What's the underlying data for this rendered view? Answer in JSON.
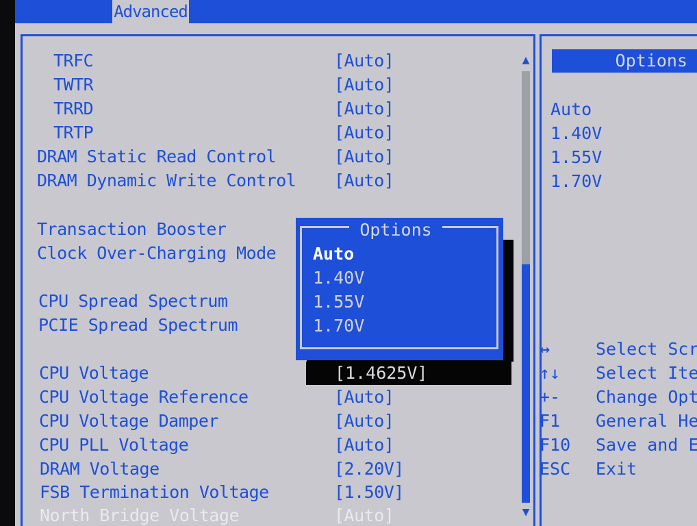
{
  "tab": "Advanced",
  "settings": [
    {
      "label": "TRFC",
      "value": "[Auto]"
    },
    {
      "label": "TWTR",
      "value": "[Auto]"
    },
    {
      "label": "TRRD",
      "value": "[Auto]"
    },
    {
      "label": "TRTP",
      "value": "[Auto]"
    },
    {
      "label": "DRAM Static Read Control",
      "value": "[Auto]"
    },
    {
      "label": "DRAM Dynamic Write Control",
      "value": "[Auto]"
    },
    {
      "label": "Transaction Booster",
      "value": ""
    },
    {
      "label": "Clock Over-Charging Mode",
      "value": ""
    },
    {
      "label": "CPU Spread Spectrum",
      "value": ""
    },
    {
      "label": "PCIE Spread Spectrum",
      "value": ""
    },
    {
      "label": "CPU Voltage",
      "value": "[1.4625V]"
    },
    {
      "label": "CPU Voltage Reference",
      "value": "[Auto]"
    },
    {
      "label": "CPU Voltage Damper",
      "value": "[Auto]"
    },
    {
      "label": "CPU PLL Voltage",
      "value": "[Auto]"
    },
    {
      "label": "DRAM Voltage",
      "value": "[2.20V]"
    },
    {
      "label": "FSB Termination Voltage",
      "value": "[1.50V]"
    },
    {
      "label": "North Bridge Voltage",
      "value": "[Auto]"
    }
  ],
  "popup": {
    "title": "Options",
    "options": [
      "Auto",
      "1.40V",
      "1.55V",
      "1.70V"
    ]
  },
  "side_options": {
    "title": "Options",
    "items": [
      "Auto",
      "1.40V",
      "1.55V",
      "1.70V"
    ]
  },
  "help": [
    {
      "key": "↔",
      "text": "Select Scr"
    },
    {
      "key": "↑↓",
      "text": "Select Ite"
    },
    {
      "key": "+-",
      "text": "Change Opt"
    },
    {
      "key": "F1",
      "text": "General He"
    },
    {
      "key": "F10",
      "text": "Save and E"
    },
    {
      "key": "ESC",
      "text": "Exit"
    }
  ]
}
